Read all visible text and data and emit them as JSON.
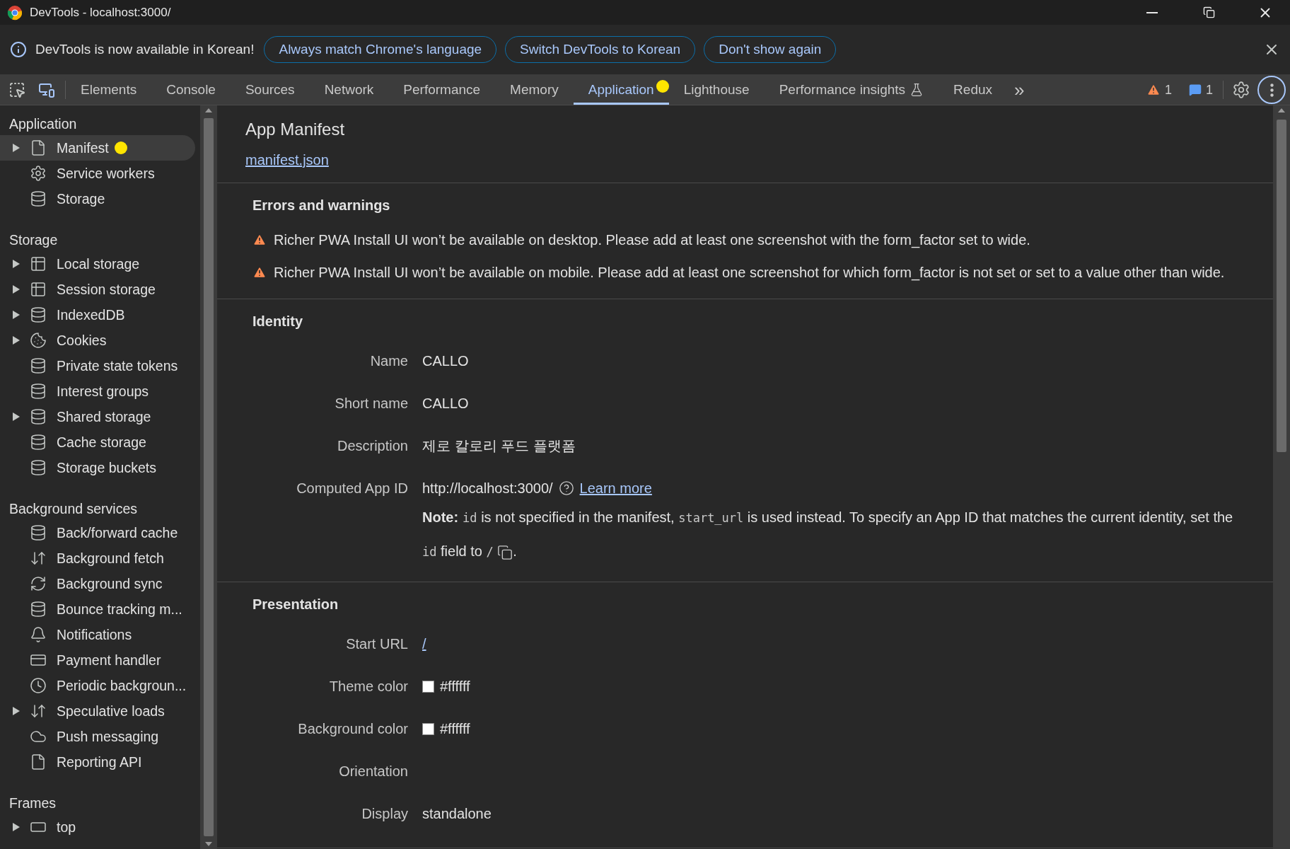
{
  "window": {
    "title": "DevTools - localhost:3000/"
  },
  "infobar": {
    "message": "DevTools is now available in Korean!",
    "buttons": [
      "Always match Chrome's language",
      "Switch DevTools to Korean",
      "Don't show again"
    ]
  },
  "tabs": [
    {
      "label": "Elements",
      "selected": false,
      "dot": false,
      "experimental": false
    },
    {
      "label": "Console",
      "selected": false,
      "dot": false,
      "experimental": false
    },
    {
      "label": "Sources",
      "selected": false,
      "dot": false,
      "experimental": false
    },
    {
      "label": "Network",
      "selected": false,
      "dot": false,
      "experimental": false
    },
    {
      "label": "Performance",
      "selected": false,
      "dot": false,
      "experimental": false
    },
    {
      "label": "Memory",
      "selected": false,
      "dot": false,
      "experimental": false
    },
    {
      "label": "Application",
      "selected": true,
      "dot": true,
      "experimental": false
    },
    {
      "label": "Lighthouse",
      "selected": false,
      "dot": false,
      "experimental": false
    },
    {
      "label": "Performance insights",
      "selected": false,
      "dot": false,
      "experimental": true
    },
    {
      "label": "Redux",
      "selected": false,
      "dot": false,
      "experimental": false
    }
  ],
  "toolbar": {
    "overflow": "»",
    "warnings": "1",
    "messages": "1"
  },
  "sidebar": {
    "sections": [
      {
        "title": "Application",
        "items": [
          {
            "label": "Manifest",
            "kind": "file",
            "expandable": true,
            "selected": true,
            "dot": true
          },
          {
            "label": "Service workers",
            "kind": "gears",
            "expandable": false,
            "selected": false,
            "dot": false
          },
          {
            "label": "Storage",
            "kind": "database",
            "expandable": false,
            "selected": false,
            "dot": false
          }
        ]
      },
      {
        "title": "Storage",
        "items": [
          {
            "label": "Local storage",
            "kind": "table",
            "expandable": true,
            "selected": false,
            "dot": false
          },
          {
            "label": "Session storage",
            "kind": "table",
            "expandable": true,
            "selected": false,
            "dot": false
          },
          {
            "label": "IndexedDB",
            "kind": "database",
            "expandable": true,
            "selected": false,
            "dot": false
          },
          {
            "label": "Cookies",
            "kind": "cookie",
            "expandable": true,
            "selected": false,
            "dot": false
          },
          {
            "label": "Private state tokens",
            "kind": "database",
            "expandable": false,
            "selected": false,
            "dot": false
          },
          {
            "label": "Interest groups",
            "kind": "database",
            "expandable": false,
            "selected": false,
            "dot": false
          },
          {
            "label": "Shared storage",
            "kind": "database",
            "expandable": true,
            "selected": false,
            "dot": false
          },
          {
            "label": "Cache storage",
            "kind": "database",
            "expandable": false,
            "selected": false,
            "dot": false
          },
          {
            "label": "Storage buckets",
            "kind": "database",
            "expandable": false,
            "selected": false,
            "dot": false
          }
        ]
      },
      {
        "title": "Background services",
        "items": [
          {
            "label": "Back/forward cache",
            "kind": "database",
            "expandable": false,
            "selected": false,
            "dot": false
          },
          {
            "label": "Background fetch",
            "kind": "arrows",
            "expandable": false,
            "selected": false,
            "dot": false
          },
          {
            "label": "Background sync",
            "kind": "sync",
            "expandable": false,
            "selected": false,
            "dot": false
          },
          {
            "label": "Bounce tracking m...",
            "kind": "database",
            "expandable": false,
            "selected": false,
            "dot": false
          },
          {
            "label": "Notifications",
            "kind": "bell",
            "expandable": false,
            "selected": false,
            "dot": false
          },
          {
            "label": "Payment handler",
            "kind": "card",
            "expandable": false,
            "selected": false,
            "dot": false
          },
          {
            "label": "Periodic backgroun...",
            "kind": "clock",
            "expandable": false,
            "selected": false,
            "dot": false
          },
          {
            "label": "Speculative loads",
            "kind": "arrows",
            "expandable": true,
            "selected": false,
            "dot": false
          },
          {
            "label": "Push messaging",
            "kind": "cloud",
            "expandable": false,
            "selected": false,
            "dot": false
          },
          {
            "label": "Reporting API",
            "kind": "file",
            "expandable": false,
            "selected": false,
            "dot": false
          }
        ]
      },
      {
        "title": "Frames",
        "items": [
          {
            "label": "top",
            "kind": "frame",
            "expandable": true,
            "selected": false,
            "dot": false
          }
        ]
      }
    ]
  },
  "manifest": {
    "title": "App Manifest",
    "link": "manifest.json",
    "errors": {
      "title": "Errors and warnings",
      "warnings": [
        "Richer PWA Install UI won’t be available on desktop. Please add at least one screenshot with the form_factor set to wide.",
        "Richer PWA Install UI won’t be available on mobile. Please add at least one screenshot for which form_factor is not set or set to a value other than wide."
      ]
    },
    "identity": {
      "title": "Identity",
      "rows": [
        {
          "kind": "text",
          "label": "Name",
          "value": "CALLO"
        },
        {
          "kind": "text",
          "label": "Short name",
          "value": "CALLO"
        },
        {
          "kind": "text",
          "label": "Description",
          "value": "제로 칼로리 푸드 플랫폼"
        },
        {
          "kind": "appid",
          "label": "Computed App ID",
          "value": "http://localhost:3000/",
          "link": "Learn more",
          "note": [
            {
              "kind": "bold",
              "text": "Note:"
            },
            {
              "kind": "code",
              "text": "id"
            },
            {
              "kind": "text",
              "text": " is not specified in the manifest, "
            },
            {
              "kind": "code",
              "text": "start_url"
            },
            {
              "kind": "text",
              "text": " is used instead. To specify an App ID that matches the current identity, set the "
            },
            {
              "kind": "code",
              "text": "id"
            },
            {
              "kind": "text",
              "text": " field to "
            },
            {
              "kind": "code",
              "text": "/"
            }
          ],
          "note_end": "."
        }
      ]
    },
    "presentation": {
      "title": "Presentation",
      "rows": [
        {
          "kind": "link",
          "label": "Start URL",
          "value": "/"
        },
        {
          "kind": "color",
          "label": "Theme color",
          "value": "#ffffff",
          "color": "#ffffff"
        },
        {
          "kind": "color",
          "label": "Background color",
          "value": "#ffffff",
          "color": "#ffffff"
        },
        {
          "kind": "empty",
          "label": "Orientation"
        },
        {
          "kind": "text",
          "label": "Display",
          "value": "standalone"
        }
      ]
    }
  }
}
